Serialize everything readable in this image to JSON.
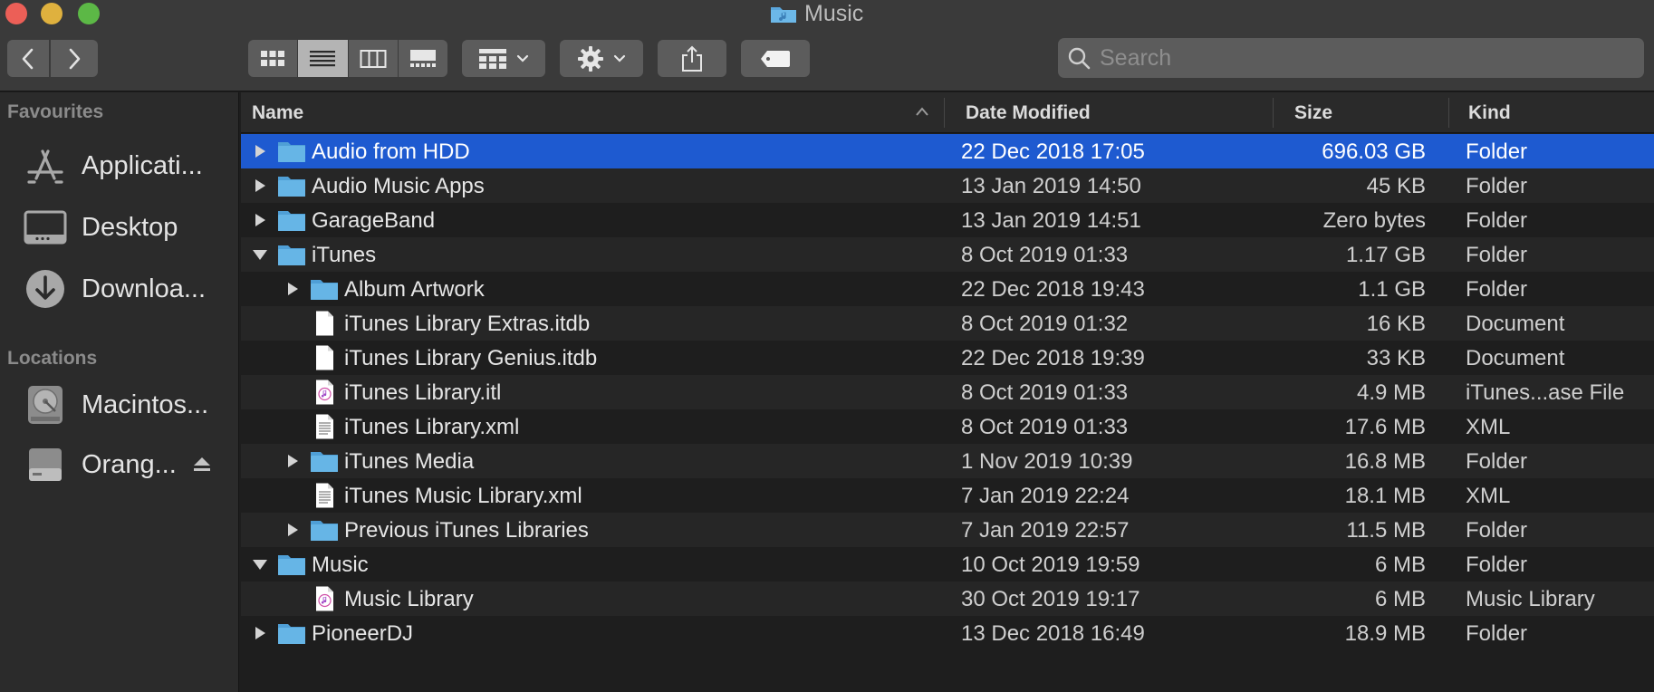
{
  "window": {
    "title": "Music",
    "title_icon": "music-folder-icon"
  },
  "toolbar": {
    "back_icon": "chevron-left-icon",
    "forward_icon": "chevron-right-icon",
    "view_modes": [
      {
        "icon": "icon-view-icon",
        "active": false
      },
      {
        "icon": "list-view-icon",
        "active": true
      },
      {
        "icon": "column-view-icon",
        "active": false
      },
      {
        "icon": "gallery-view-icon",
        "active": false
      }
    ],
    "group_icon": "group-grid-icon",
    "action_icon": "gear-icon",
    "share_icon": "share-icon",
    "tag_icon": "tag-icon"
  },
  "search": {
    "placeholder": "Search",
    "value": ""
  },
  "sidebar": {
    "favourites_heading": "Favourites",
    "favourites": [
      {
        "label": "Applicati...",
        "icon": "applications-icon"
      },
      {
        "label": "Desktop",
        "icon": "desktop-icon"
      },
      {
        "label": "Downloa...",
        "icon": "downloads-icon"
      }
    ],
    "locations_heading": "Locations",
    "locations": [
      {
        "label": "Macintos...",
        "icon": "hard-disk-icon"
      },
      {
        "label": "Orang...",
        "icon": "external-drive-icon",
        "ejectable": true
      }
    ]
  },
  "columns": {
    "name": "Name",
    "date": "Date Modified",
    "size": "Size",
    "kind": "Kind"
  },
  "files": [
    {
      "name": "Audio from HDD",
      "date": "22 Dec 2018 17:05",
      "size": "696.03 GB",
      "kind": "Folder",
      "type": "folder",
      "level": 0,
      "disclosure": "collapsed",
      "selected": true
    },
    {
      "name": "Audio Music Apps",
      "date": "13 Jan 2019 14:50",
      "size": "45 KB",
      "kind": "Folder",
      "type": "folder",
      "level": 0,
      "disclosure": "collapsed",
      "selected": false
    },
    {
      "name": "GarageBand",
      "date": "13 Jan 2019 14:51",
      "size": "Zero bytes",
      "kind": "Folder",
      "type": "folder",
      "level": 0,
      "disclosure": "collapsed",
      "selected": false
    },
    {
      "name": "iTunes",
      "date": "8 Oct 2019 01:33",
      "size": "1.17 GB",
      "kind": "Folder",
      "type": "folder",
      "level": 0,
      "disclosure": "expanded",
      "selected": false
    },
    {
      "name": "Album Artwork",
      "date": "22 Dec 2018 19:43",
      "size": "1.1 GB",
      "kind": "Folder",
      "type": "folder",
      "level": 1,
      "disclosure": "collapsed",
      "selected": false
    },
    {
      "name": "iTunes Library Extras.itdb",
      "date": "8 Oct 2019 01:32",
      "size": "16 KB",
      "kind": "Document",
      "type": "document",
      "level": 1,
      "disclosure": "none",
      "selected": false
    },
    {
      "name": "iTunes Library Genius.itdb",
      "date": "22 Dec 2018 19:39",
      "size": "33 KB",
      "kind": "Document",
      "type": "document",
      "level": 1,
      "disclosure": "none",
      "selected": false
    },
    {
      "name": "iTunes Library.itl",
      "date": "8 Oct 2019 01:33",
      "size": "4.9 MB",
      "kind": "iTunes...ase File",
      "type": "itunes",
      "level": 1,
      "disclosure": "none",
      "selected": false
    },
    {
      "name": "iTunes Library.xml",
      "date": "8 Oct 2019 01:33",
      "size": "17.6 MB",
      "kind": "XML",
      "type": "xml",
      "level": 1,
      "disclosure": "none",
      "selected": false
    },
    {
      "name": "iTunes Media",
      "date": "1 Nov 2019 10:39",
      "size": "16.8 MB",
      "kind": "Folder",
      "type": "folder",
      "level": 1,
      "disclosure": "collapsed",
      "selected": false
    },
    {
      "name": "iTunes Music Library.xml",
      "date": "7 Jan 2019 22:24",
      "size": "18.1 MB",
      "kind": "XML",
      "type": "xml",
      "level": 1,
      "disclosure": "none",
      "selected": false
    },
    {
      "name": "Previous iTunes Libraries",
      "date": "7 Jan 2019 22:57",
      "size": "11.5 MB",
      "kind": "Folder",
      "type": "folder",
      "level": 1,
      "disclosure": "collapsed",
      "selected": false
    },
    {
      "name": "Music",
      "date": "10 Oct 2019 19:59",
      "size": "6 MB",
      "kind": "Folder",
      "type": "folder",
      "level": 0,
      "disclosure": "expanded",
      "selected": false
    },
    {
      "name": "Music Library",
      "date": "30 Oct 2019 19:17",
      "size": "6 MB",
      "kind": "Music Library",
      "type": "itunes",
      "level": 1,
      "disclosure": "none",
      "selected": false
    },
    {
      "name": "PioneerDJ",
      "date": "13 Dec 2018 16:49",
      "size": "18.9 MB",
      "kind": "Folder",
      "type": "folder",
      "level": 0,
      "disclosure": "collapsed",
      "selected": false
    }
  ],
  "colors": {
    "selection": "#1e5ad0",
    "folder": "#66b5e6",
    "folder_tab": "#4f9fd6"
  }
}
